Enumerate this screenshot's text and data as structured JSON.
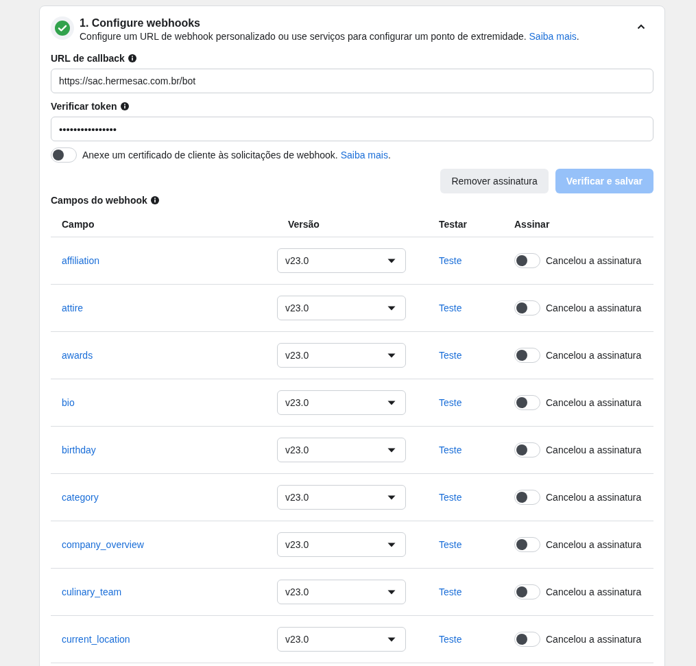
{
  "section": {
    "completed": true,
    "expanded": true,
    "title": "1. Configure webhooks",
    "description": "Configure um URL de webhook personalizado ou use serviços para configurar um ponto de extremidade.",
    "description_link": "Saiba mais",
    "description_end": "."
  },
  "callback_url": {
    "label": "URL de callback",
    "value": "https://sac.hermesac.com.br/bot"
  },
  "verify_token": {
    "label": "Verificar token",
    "value": "••••••••••••••••"
  },
  "client_certificate": {
    "on": false,
    "text": "Anexe um certificado de cliente às solicitações de webhook.",
    "link": "Saiba mais",
    "end": "."
  },
  "buttons": [
    {
      "label": "Remover assinatura",
      "kind": "secondary",
      "disabled": false
    },
    {
      "label": "Verificar e salvar",
      "kind": "primary",
      "disabled": true
    }
  ],
  "fields_title": "Campos do webhook",
  "table": {
    "columns": [
      "Campo",
      "Versão",
      "Testar",
      "Assinar"
    ],
    "rows": [
      {
        "field": "affiliation",
        "version": "v23.0",
        "test": "Teste",
        "subscribed": false,
        "status": "Cancelou a assinatura"
      },
      {
        "field": "attire",
        "version": "v23.0",
        "test": "Teste",
        "subscribed": false,
        "status": "Cancelou a assinatura"
      },
      {
        "field": "awards",
        "version": "v23.0",
        "test": "Teste",
        "subscribed": false,
        "status": "Cancelou a assinatura"
      },
      {
        "field": "bio",
        "version": "v23.0",
        "test": "Teste",
        "subscribed": false,
        "status": "Cancelou a assinatura"
      },
      {
        "field": "birthday",
        "version": "v23.0",
        "test": "Teste",
        "subscribed": false,
        "status": "Cancelou a assinatura"
      },
      {
        "field": "category",
        "version": "v23.0",
        "test": "Teste",
        "subscribed": false,
        "status": "Cancelou a assinatura"
      },
      {
        "field": "company_overview",
        "version": "v23.0",
        "test": "Teste",
        "subscribed": false,
        "status": "Cancelou a assinatura"
      },
      {
        "field": "culinary_team",
        "version": "v23.0",
        "test": "Teste",
        "subscribed": false,
        "status": "Cancelou a assinatura"
      },
      {
        "field": "current_location",
        "version": "v23.0",
        "test": "Teste",
        "subscribed": false,
        "status": "Cancelou a assinatura"
      }
    ]
  }
}
